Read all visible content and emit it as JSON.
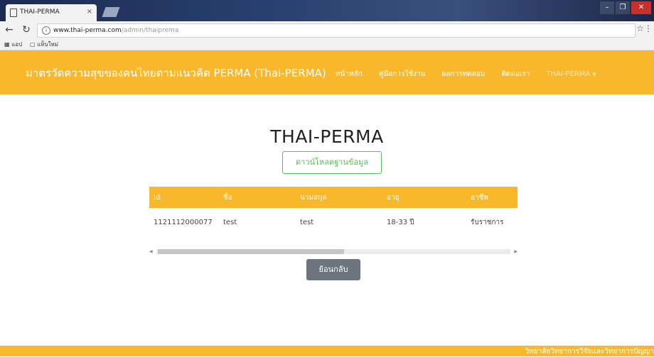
{
  "browser": {
    "tab_title": "THAI-PERMA",
    "tab_close": "×",
    "url_host": "www.thai-perma.com",
    "url_path": "/admin/thaiprema",
    "bookmarks": [
      "แอป",
      "แท็บใหม่"
    ]
  },
  "navbar": {
    "brand": "มาตรวัดความสุขของคนไทยตามแนวคิด PERMA (Thai-PERMA)",
    "links": [
      "หน้าหลัก",
      "คู่มือการใช้งาน",
      "ผลการทดสอบ",
      "ติดต่อเรา"
    ],
    "dropdown_label": "THAI-PERMA",
    "dropdown_caret": "▼"
  },
  "main": {
    "title": "THAI-PERMA",
    "download_button": "ดาวน์โหลดฐานข้อมูล",
    "back_button": "ย้อนกลับ"
  },
  "table": {
    "headers": [
      "Id",
      "ชื่อ",
      "นามสกุล",
      "อายุ",
      "อาชีพ"
    ],
    "rows": [
      [
        "1121112000077",
        "test",
        "test",
        "18-33 ปี",
        "รับราชการ"
      ]
    ]
  },
  "footer": {
    "text": "วิทยาลัยวิทยาการวิจัยและวิทยาการปัญญา"
  },
  "colors": {
    "primary": "#f9b82b",
    "success": "#5cb85c",
    "secondary": "#6c757d"
  }
}
